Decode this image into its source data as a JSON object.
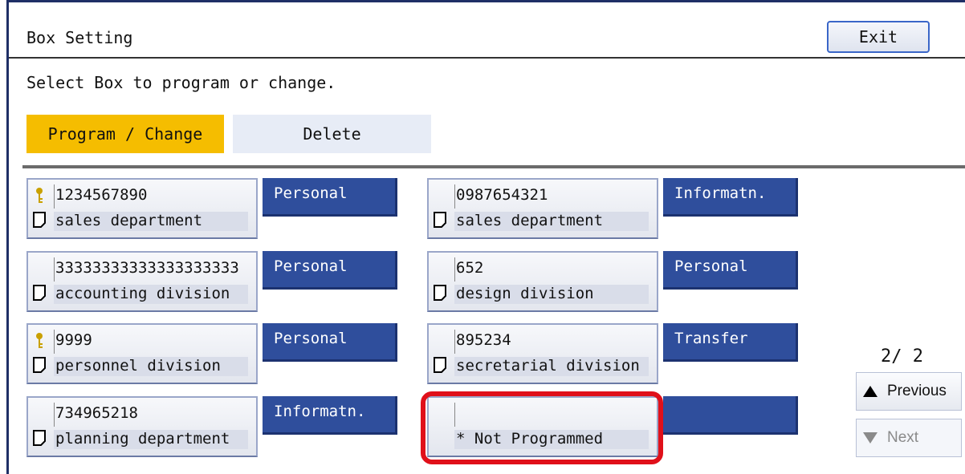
{
  "header": {
    "title": "Box Setting",
    "exit_label": "Exit"
  },
  "instruction": "Select Box to program or change.",
  "modes": {
    "program": "Program / Change",
    "delete": "Delete"
  },
  "boxes": [
    {
      "number": "1234567890",
      "name": "sales department",
      "type": "Personal",
      "locked": true
    },
    {
      "number": "0987654321",
      "name": "sales department",
      "type": "Informatn.",
      "locked": false
    },
    {
      "number": "33333333333333333333",
      "name": "accounting division",
      "type": "Personal",
      "locked": false
    },
    {
      "number": "652",
      "name": "design division",
      "type": "Personal",
      "locked": false
    },
    {
      "number": "9999",
      "name": "personnel division",
      "type": "Personal",
      "locked": true
    },
    {
      "number": "895234",
      "name": "secretarial division",
      "type": "Transfer",
      "locked": false
    },
    {
      "number": "734965218",
      "name": "planning department",
      "type": "Informatn.",
      "locked": false
    },
    {
      "number": "",
      "name": "* Not Programmed",
      "type": "",
      "locked": false
    }
  ],
  "pager": {
    "indicator": "2∕ 2",
    "previous": "Previous",
    "next": "Next"
  },
  "colors": {
    "accent": "#f5bd00",
    "tag": "#2f4e9c",
    "highlight": "#e0101a"
  },
  "icons": {
    "lock": "key-icon",
    "document": "doc-icon"
  }
}
